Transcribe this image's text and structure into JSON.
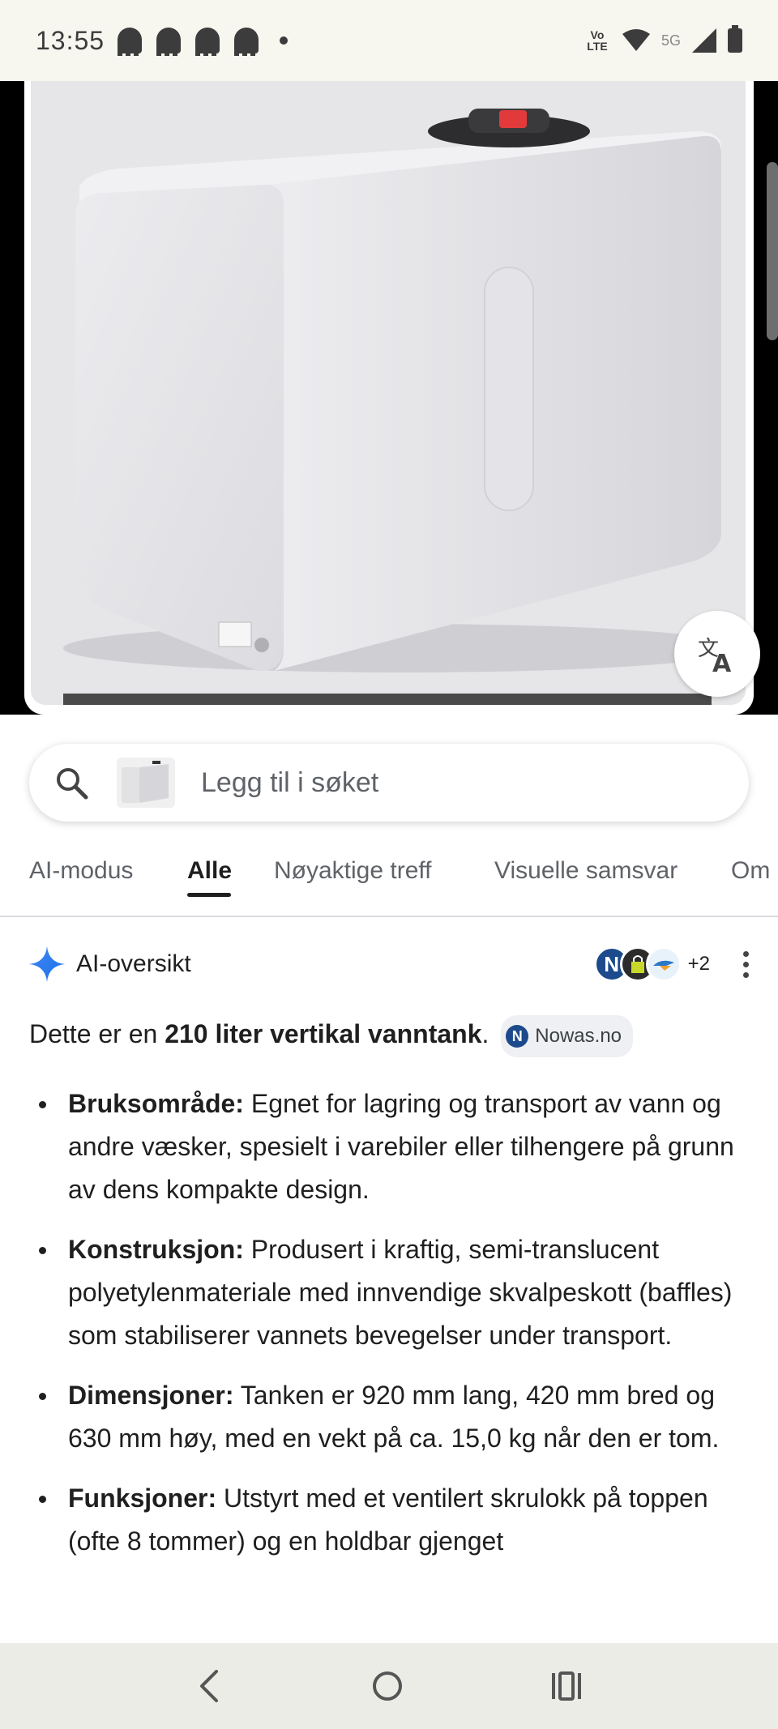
{
  "status_bar": {
    "time": "13:55",
    "volte": "Vo LTE",
    "network": "5G"
  },
  "image_viewer": {
    "alt": "white rectangular water tank",
    "translate_icon": "translate-icon"
  },
  "search": {
    "placeholder": "Legg til i søket",
    "icon": "search-icon"
  },
  "tabs": [
    {
      "label": "AI-modus",
      "active": false
    },
    {
      "label": "Alle",
      "active": true
    },
    {
      "label": "Nøyaktige treff",
      "active": false
    },
    {
      "label": "Visuelle samsvar",
      "active": false
    },
    {
      "label": "Om",
      "active": false
    }
  ],
  "ai_overview": {
    "title": "AI-oversikt",
    "source_count": "+2",
    "source_n_letter": "N",
    "lead_prefix": "Dette er en ",
    "lead_bold": "210 liter vertikal vanntank",
    "lead_suffix": ".",
    "chip_label": "Nowas.no",
    "bullets": [
      {
        "label": "Bruksområde:",
        "text": " Egnet for lagring og transport av vann og andre væsker, spesielt i varebiler eller tilhengere på grunn av dens kompakte design."
      },
      {
        "label": "Konstruksjon:",
        "text": " Produsert i kraftig, semi-translucent polyetylenmateriale med innvendige skvalpeskott (baffles) som stabiliserer vannets bevegelser under transport."
      },
      {
        "label": "Dimensjoner:",
        "text": " Tanken er 920 mm lang, 420 mm bred og 630 mm høy, med en vekt på ca. 15,0 kg når den er tom."
      },
      {
        "label": "Funksjoner:",
        "text": " Utstyrt med et ventilert skrulokk på toppen (ofte 8 tommer) og en holdbar gjenget"
      }
    ]
  },
  "nav": {
    "back": "back-icon",
    "home": "home-icon",
    "recents": "recents-icon"
  }
}
